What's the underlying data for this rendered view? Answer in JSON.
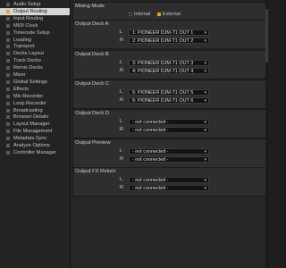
{
  "sidebar": {
    "items": [
      {
        "label": "Audio Setup",
        "active": false
      },
      {
        "label": "Output Routing",
        "active": true
      },
      {
        "label": "Input Routing",
        "active": false
      },
      {
        "label": "MIDI Clock",
        "active": false
      },
      {
        "label": "Timecode Setup",
        "active": false
      },
      {
        "label": "Loading",
        "active": false
      },
      {
        "label": "Transport",
        "active": false
      },
      {
        "label": "Decks Layout",
        "active": false
      },
      {
        "label": "Track Decks",
        "active": false
      },
      {
        "label": "Remix Decks",
        "active": false
      },
      {
        "label": "Mixer",
        "active": false
      },
      {
        "label": "Global Settings",
        "active": false
      },
      {
        "label": "Effects",
        "active": false
      },
      {
        "label": "Mix Recorder",
        "active": false
      },
      {
        "label": "Loop Recorder",
        "active": false
      },
      {
        "label": "Broadcasting",
        "active": false
      },
      {
        "label": "Browser Details",
        "active": false
      },
      {
        "label": "Layout Manager",
        "active": false
      },
      {
        "label": "File Management",
        "active": false
      },
      {
        "label": "Metadata Sync",
        "active": false
      },
      {
        "label": "Analyze Options",
        "active": false
      },
      {
        "label": "Controller Manager",
        "active": false
      }
    ]
  },
  "mixing_mode": {
    "title": "Mixing Mode",
    "options": [
      {
        "label": "Internal",
        "selected": false
      },
      {
        "label": "External",
        "selected": true
      }
    ]
  },
  "sections": [
    {
      "title": "Output Deck A",
      "L": "1: PIONEER DJM-T1 OUT 1",
      "R": "2: PIONEER DJM-T1 OUT 2"
    },
    {
      "title": "Output Deck B",
      "L": "3: PIONEER DJM-T1 OUT 3",
      "R": "4: PIONEER DJM-T1 OUT 4"
    },
    {
      "title": "Output Deck C",
      "L": "5: PIONEER DJM-T1 OUT 5",
      "R": "6: PIONEER DJM-T1 OUT 6"
    },
    {
      "title": "Output Deck D",
      "L": "- not connected -",
      "R": "- not connected -"
    },
    {
      "title": "Output Preview",
      "L": "- not connected -",
      "R": "- not connected -"
    },
    {
      "title": "Output FX Return",
      "L": "- not connected -",
      "R": "- not connected -"
    }
  ],
  "channel_labels": {
    "left": "L",
    "right": "R"
  },
  "colors": {
    "accent": "#f0a020",
    "active_item_bg": "#d6d6d6"
  },
  "icons": {
    "dropdown": "chevron-down-icon",
    "sidebar_marker": "square-marker-icon"
  }
}
